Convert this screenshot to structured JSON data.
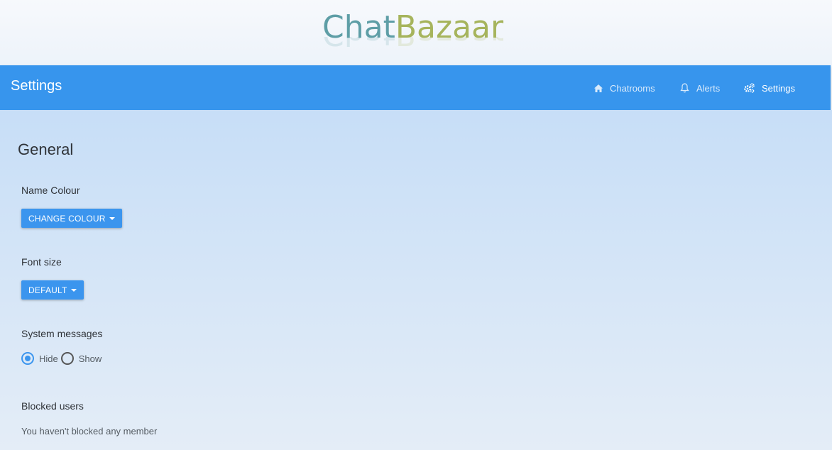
{
  "logo": {
    "part1": "Chat",
    "part2": "Bazaar"
  },
  "navbar": {
    "title": "Settings",
    "items": [
      {
        "label": "Chatrooms",
        "icon": "home-icon"
      },
      {
        "label": "Alerts",
        "icon": "bell-icon"
      },
      {
        "label": "Settings",
        "icon": "gears-icon"
      }
    ]
  },
  "general": {
    "title": "General",
    "name_colour": {
      "label": "Name Colour",
      "button": "CHANGE COLOUR"
    },
    "font_size": {
      "label": "Font size",
      "button": "DEFAULT"
    },
    "system_messages": {
      "label": "System messages",
      "options": [
        "Hide",
        "Show"
      ],
      "selected": "Hide"
    },
    "blocked_users": {
      "label": "Blocked users",
      "text": "You haven't blocked any member"
    }
  },
  "colors": {
    "navbar": "#3795ed",
    "accent": "#3b95ee"
  }
}
